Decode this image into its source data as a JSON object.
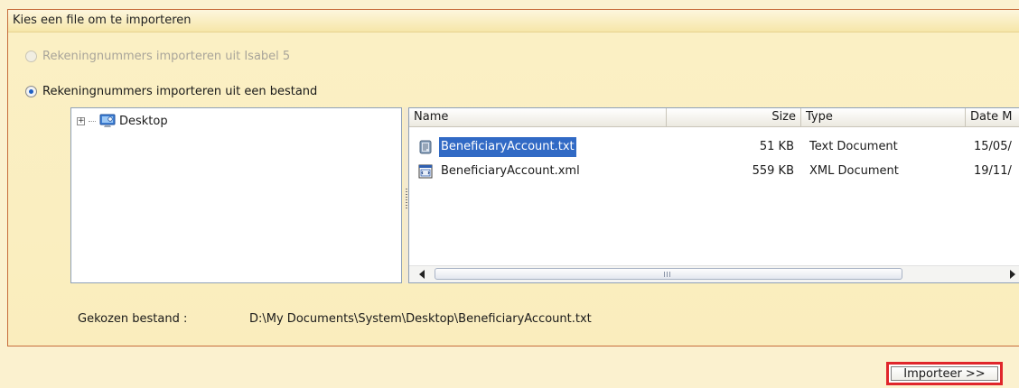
{
  "panel": {
    "title": "Kies een file om te importeren"
  },
  "options": {
    "isabel_label": "Rekeningnummers importeren uit Isabel 5",
    "file_label": "Rekeningnummers importeren uit een bestand",
    "selected": "file"
  },
  "tree": {
    "root_label": "Desktop",
    "expander": "+"
  },
  "list": {
    "columns": {
      "name": "Name",
      "size": "Size",
      "type": "Type",
      "date": "Date M"
    },
    "files": [
      {
        "name": "BeneficiaryAccount.txt",
        "size": "51 KB",
        "type": "Text Document",
        "date": "15/05/",
        "icon": "text-file-icon",
        "selected": true
      },
      {
        "name": "BeneficiaryAccount.xml",
        "size": "559 KB",
        "type": "XML Document",
        "date": "19/11/",
        "icon": "xml-file-icon",
        "selected": false
      }
    ]
  },
  "chosen": {
    "label": "Gekozen bestand :",
    "path": "D:\\My Documents\\System\\Desktop\\BeneficiaryAccount.txt"
  },
  "import_button": {
    "label": "Importeer >>"
  },
  "colors": {
    "panel_border": "#c76d3c",
    "selection": "#316ac5",
    "highlight_box": "#e0262b"
  }
}
